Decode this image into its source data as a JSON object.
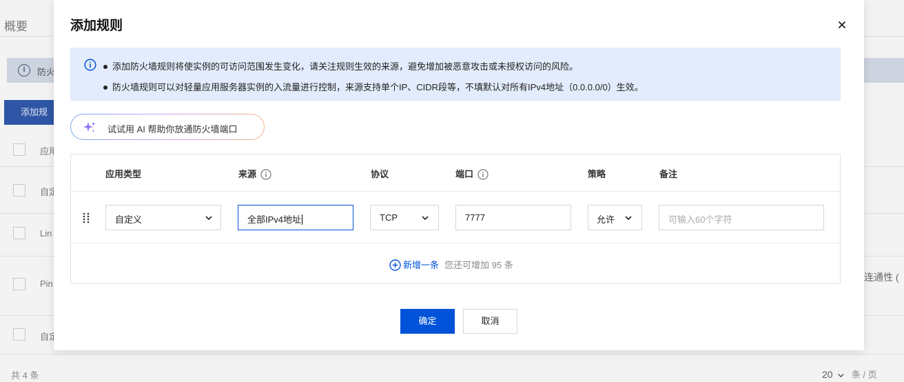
{
  "background": {
    "page_title": "概要",
    "notice_text": "防火",
    "add_button": "添加规",
    "rows": [
      "应用",
      "自定",
      "Lin",
      "Pin",
      "自定"
    ],
    "side_text": "连通性 (",
    "footer_total": "共 4 条",
    "page_size": "20",
    "page_unit": "条 / 页"
  },
  "modal": {
    "title": "添加规则",
    "info": {
      "line1": "添加防火墙规则将使实例的可访问范围发生变化，请关注规则生效的来源，避免增加被恶意攻击或未授权访问的风险。",
      "line2": "防火墙规则可以对轻量应用服务器实例的入流量进行控制，来源支持单个IP、CIDR段等，不填默认对所有IPv4地址（0.0.0.0/0）生效。"
    },
    "ai_assist": "试试用 AI 帮助你放通防火墙端口",
    "table": {
      "headers": {
        "app_type": "应用类型",
        "source": "来源",
        "protocol": "协议",
        "port": "端口",
        "policy": "策略",
        "remark": "备注"
      },
      "row": {
        "app_type": "自定义",
        "source": "全部IPv4地址",
        "protocol": "TCP",
        "port": "7777",
        "policy": "允许",
        "remark_placeholder": "可输入60个字符"
      },
      "add_link": "新增一条",
      "add_hint": "您还可增加 95 条"
    },
    "confirm": "确定",
    "cancel": "取消"
  },
  "colors": {
    "primary": "#0052d9",
    "info_bg": "#e3ecfc"
  }
}
